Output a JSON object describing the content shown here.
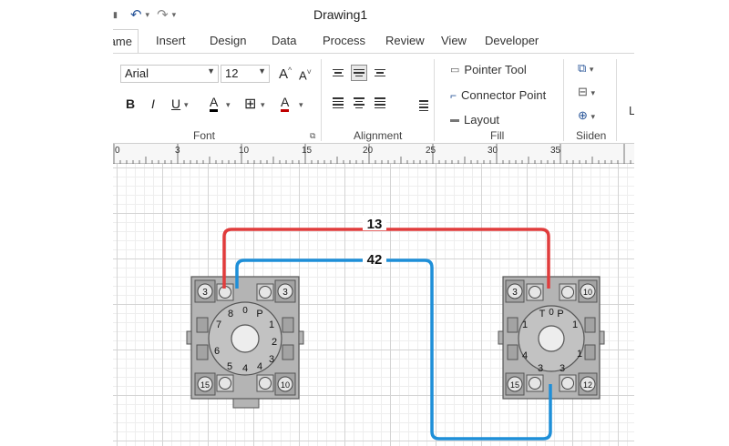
{
  "window": {
    "title": "Drawing1"
  },
  "quick_access": {
    "undo_icon": "undo-icon",
    "redo_icon": "redo-icon"
  },
  "tabs": [
    {
      "label": "ame",
      "active": true
    },
    {
      "label": "Insert"
    },
    {
      "label": "Design"
    },
    {
      "label": "Data"
    },
    {
      "label": "Process"
    },
    {
      "label": "Review"
    },
    {
      "label": "View"
    },
    {
      "label": "Developer"
    }
  ],
  "ribbon": {
    "font": {
      "family": "Arial",
      "size": "12",
      "grow_label": "A",
      "shrink_label": "A",
      "bold": "B",
      "italic": "I",
      "underline": "U",
      "font_color_label": "A",
      "fill_color_label": "A",
      "font_color": "#000000",
      "fill_color": "#c00000",
      "label": "Font"
    },
    "alignment": {
      "label": "Alignment"
    },
    "tools": {
      "pointer": "Pointer Tool",
      "connector": "Connector Point",
      "layout": "Layout",
      "label": "Fill"
    },
    "arrange": {
      "label": "Siiden"
    },
    "overflow": "L"
  },
  "ruler": {
    "labels": [
      "0",
      "3",
      "10",
      "15",
      "20",
      "25",
      "30",
      "35"
    ]
  },
  "diagram": {
    "connector_red": {
      "label": "13",
      "color": "#e03c3c"
    },
    "connector_blue": {
      "label": "42",
      "color": "#1e8fd8"
    },
    "socket_left": {
      "terminals": [
        "3",
        "3",
        "15",
        "10"
      ],
      "pins": [
        "8",
        "0",
        "P",
        "1",
        "7",
        "2",
        "6",
        "3",
        "5",
        "4",
        "4"
      ]
    },
    "socket_right": {
      "terminals": [
        "3",
        "10",
        "15",
        "12"
      ],
      "pins": [
        "T",
        "0",
        "P",
        "1",
        "1",
        "4",
        "1",
        "3",
        "3"
      ]
    }
  }
}
